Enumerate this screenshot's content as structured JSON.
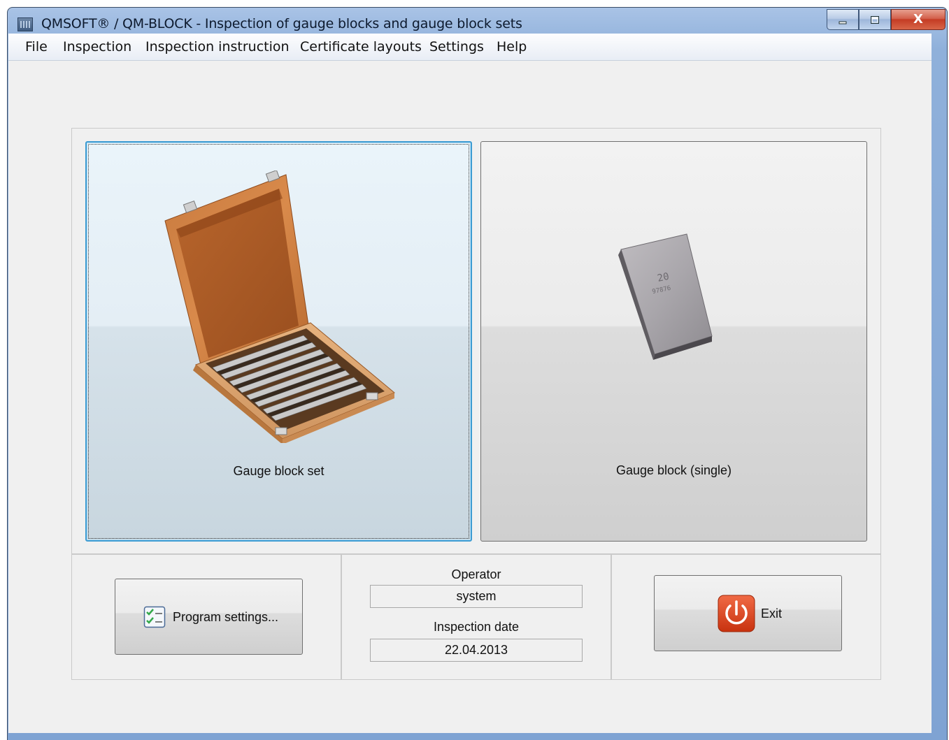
{
  "window": {
    "title": "QMSOFT® / QM-BLOCK - Inspection of gauge blocks and gauge block sets",
    "controls": {
      "minimize_icon": "minimize-icon",
      "maximize_icon": "maximize-icon",
      "close_label": "X"
    }
  },
  "menu": {
    "items": [
      "File",
      "Inspection",
      "Inspection instruction",
      "Certificate layouts",
      "Settings",
      "Help"
    ]
  },
  "choices": {
    "set_label": "Gauge block set",
    "single_label": "Gauge block (single)",
    "block_marking_top": "20",
    "block_marking_bottom": "97876"
  },
  "bottom": {
    "program_settings_label": "Program settings...",
    "operator_label": "Operator",
    "operator_value": "system",
    "inspection_date_label": "Inspection date",
    "inspection_date_value": "22.04.2013",
    "exit_label": "Exit"
  },
  "colors": {
    "titlebar": "#8fb0da",
    "focus_border": "#3c9bd2",
    "exit_icon_red": "#d9401e",
    "client_bg": "#f0f0f0"
  }
}
